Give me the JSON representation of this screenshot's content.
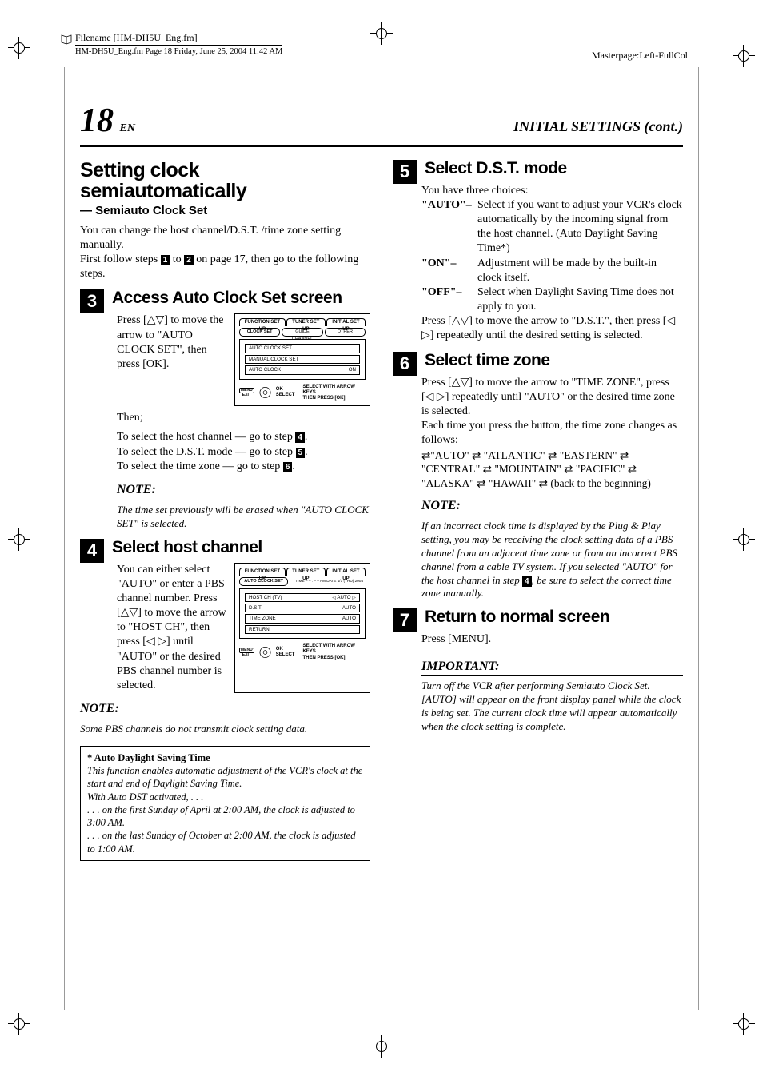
{
  "header": {
    "filename_label": "Filename [HM-DH5U_Eng.fm]",
    "meta": "HM-DH5U_Eng.fm  Page 18  Friday, June 25, 2004  11:42 AM",
    "masterpage": "Masterpage:Left-FullCol"
  },
  "titlebar": {
    "page_number": "18",
    "en": "EN",
    "section": "INITIAL SETTINGS (cont.)"
  },
  "left": {
    "h1": "Setting clock semiautomatically",
    "sub1": "— Semiauto Clock Set",
    "intro1": "You can change the host channel/D.S.T. /time zone setting manually.",
    "intro2a": "First follow steps ",
    "intro2_step1": "1",
    "intro2b": " to ",
    "intro2_step2": "2",
    "intro2c": " on page 17, then go to the following steps.",
    "step3": {
      "num": "3",
      "title": "Access Auto Clock Set screen",
      "body": "Press [△▽] to move the arrow to \"AUTO CLOCK SET\", then press [OK].",
      "then": "Then;",
      "line1a": "To select the host channel — go to step ",
      "line1_num": "4",
      "line1b": ".",
      "line2a": "To select the D.S.T. mode — go to step ",
      "line2_num": "5",
      "line2b": ".",
      "line3a": "To select the time zone — go to step ",
      "line3_num": "6",
      "line3b": ".",
      "osd": {
        "tab1": "FUNCTION SET UP",
        "tab2": "TUNER SET UP",
        "tab3": "INITIAL SET UP",
        "sub1": "CLOCK SET",
        "sub2": "GUIDE CHANNEL",
        "sub3": "OTHER",
        "item1": "AUTO CLOCK SET",
        "item2": "MANUAL CLOCK SET",
        "item3_l": "AUTO CLOCK",
        "item3_r": "ON",
        "menu": "MENU",
        "exit": "EXIT",
        "ok": "OK",
        "select": "SELECT",
        "help1": "SELECT WITH ARROW KEYS",
        "help2": "THEN PRESS [OK]"
      }
    },
    "note3": {
      "h": "NOTE:",
      "body": "The time set previously will be erased when \"AUTO CLOCK SET\" is selected."
    },
    "step4": {
      "num": "4",
      "title": "Select host channel",
      "body": "You can either select \"AUTO\" or enter a PBS channel number. Press [△▽] to move the arrow to \"HOST CH\", then press [◁ ▷] until \"AUTO\" or the desired PBS channel number is selected.",
      "osd": {
        "tab1": "FUNCTION SET UP",
        "tab2": "TUNER SET UP",
        "tab3": "INITIAL SET UP",
        "sub1": "AUTO CLOCK SET",
        "sub_right": "TIME – – : – – AM DATE 1/1 (THU) 2004",
        "hostch_l": "HOST CH   (TV)",
        "hostch_r": "◁   AUTO   ▷",
        "dst_l": "D.S.T",
        "dst_r": "AUTO",
        "tz_l": "TIME ZONE",
        "tz_r": "AUTO",
        "ret": "RETURN",
        "menu": "MENU",
        "exit": "EXIT",
        "ok": "OK",
        "select": "SELECT",
        "help1": "SELECT WITH ARROW KEYS",
        "help2": "THEN PRESS [OK]"
      }
    },
    "note4": {
      "h": "NOTE:",
      "body": "Some PBS channels do not transmit clock setting data."
    },
    "autodst": {
      "title": "* Auto Daylight Saving Time",
      "l1": "This function enables automatic adjustment of the VCR's clock at the start and end of Daylight Saving Time.",
      "l2": "With Auto DST activated, . . .",
      "l3": ". . . on the first Sunday of April at 2:00 AM, the clock is adjusted to 3:00 AM.",
      "l4": ". . . on the last Sunday of October at 2:00 AM, the clock is adjusted to 1:00 AM."
    }
  },
  "right": {
    "step5": {
      "num": "5",
      "title": "Select D.S.T. mode",
      "intro": "You have three choices:",
      "auto_k": "\"AUTO\"–",
      "auto_v": "Select if you want to adjust your VCR's clock automatically by the incoming signal from the host channel. (Auto Daylight Saving Time*)",
      "on_k": "\"ON\"–",
      "on_v": "Adjustment will be made by the built-in clock itself.",
      "off_k": "\"OFF\"–",
      "off_v": "Select when Daylight Saving Time does not apply to you.",
      "tail": "Press [△▽] to move the arrow to \"D.S.T.\", then press [◁ ▷] repeatedly until the desired setting is selected."
    },
    "step6": {
      "num": "6",
      "title": "Select time zone",
      "p1": "Press [△▽] to move the arrow to \"TIME ZONE\", press [◁ ▷] repeatedly until \"AUTO\" or the desired time zone is selected.",
      "p2": "Each time you press the button, the time zone changes as follows:",
      "tz": "⇄\"AUTO\" ⇄ \"ATLANTIC\" ⇄ \"EASTERN\" ⇄ \"CENTRAL\" ⇄ \"MOUNTAIN\" ⇄ \"PACIFIC\" ⇄ \"ALASKA\" ⇄ \"HAWAII\" ⇄ (back to the beginning)",
      "note_h": "NOTE:",
      "note_1": "If an incorrect clock time is displayed by the Plug & Play setting, you may be receiving the clock setting data of a PBS channel from an adjacent time zone or from an incorrect PBS channel from a cable TV system. If you selected \"AUTO\" for the host channel in step ",
      "note_num": "4",
      "note_2": ", be sure to select the correct time zone manually."
    },
    "step7": {
      "num": "7",
      "title": "Return to normal screen",
      "body": "Press [MENU]."
    },
    "important": {
      "h": "IMPORTANT:",
      "body": "Turn off the VCR after performing Semiauto Clock Set. [AUTO] will appear on the front display panel while the clock is being set. The current clock time will appear automatically when the clock setting is complete."
    }
  }
}
